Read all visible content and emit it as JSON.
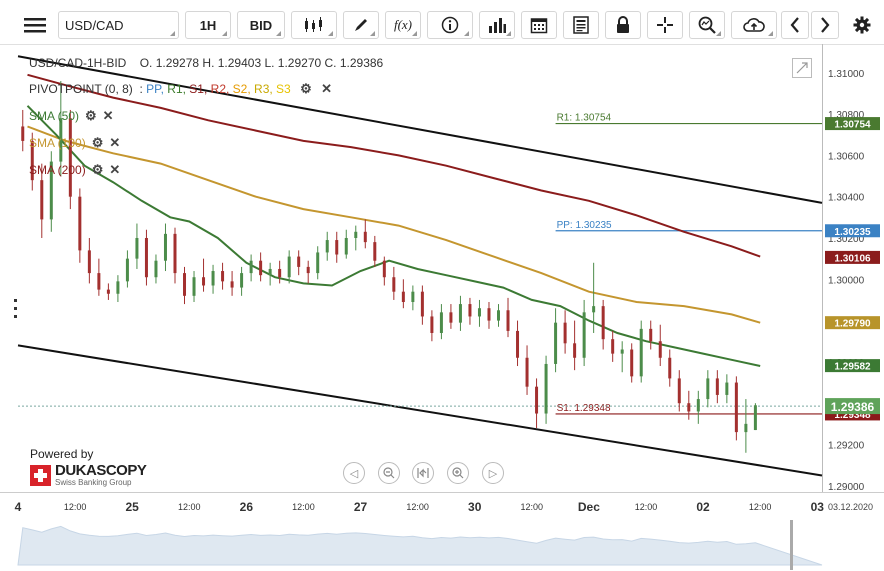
{
  "toolbar": {
    "symbol": "USD/CAD",
    "timeframe": "1H",
    "price_type": "BID",
    "icons": [
      "menu-icon",
      "candles-icon",
      "draw-icon",
      "function-icon",
      "info-icon",
      "bars-icon",
      "calendar-icon",
      "news-icon",
      "lock-icon",
      "crosshair-icon",
      "zoom-icon",
      "cloud-icon",
      "arrow-left-icon",
      "arrow-right-icon",
      "settings-icon"
    ],
    "function_label": "f(x)"
  },
  "header": {
    "instrument": "USD/CAD-1H-BID",
    "ohlc": "O. 1.29278 H. 1.29403 L. 1.29270 C. 1.29386"
  },
  "pivot": {
    "label": "PIVOTPOINT (0, 8)",
    "items": [
      {
        "text": "PP,",
        "color": "#3b82c4"
      },
      {
        "text": "R1,",
        "color": "#3a7a2a"
      },
      {
        "text": "S1,",
        "color": "#8b1a1a"
      },
      {
        "text": "R2,",
        "color": "#c0392b"
      },
      {
        "text": "S2,",
        "color": "#e69b00"
      },
      {
        "text": "R3,",
        "color": "#c8a800"
      },
      {
        "text": "S3",
        "color": "#e6c200"
      }
    ]
  },
  "indicators": [
    {
      "label": "SMA (50)",
      "color": "#3c7a34"
    },
    {
      "label": "SMA (100)",
      "color": "#c4962f"
    },
    {
      "label": "SMA (200)",
      "color": "#8b1c1c"
    }
  ],
  "branding": {
    "powered_by": "Powered by",
    "name": "DUKASCOPY",
    "tagline": "Swiss Banking Group"
  },
  "current_date": "03.12.2020",
  "chart_data": {
    "type": "candlestick",
    "y_ticks": [
      "1.31000",
      "1.30800",
      "1.30600",
      "1.30400",
      "1.30200",
      "1.30000",
      "1.29800",
      "1.29600",
      "1.29400",
      "1.29200",
      "1.29000"
    ],
    "ylim": [
      1.2897,
      1.3112
    ],
    "x_labels": [
      {
        "text": "4",
        "bold": true,
        "t": 0
      },
      {
        "text": "12:00",
        "bold": false,
        "t": 12
      },
      {
        "text": "25",
        "bold": true,
        "t": 24
      },
      {
        "text": "12:00",
        "bold": false,
        "t": 36
      },
      {
        "text": "26",
        "bold": true,
        "t": 48
      },
      {
        "text": "12:00",
        "bold": false,
        "t": 60
      },
      {
        "text": "27",
        "bold": true,
        "t": 72
      },
      {
        "text": "12:00",
        "bold": false,
        "t": 84
      },
      {
        "text": "30",
        "bold": true,
        "t": 96
      },
      {
        "text": "12:00",
        "bold": false,
        "t": 108
      },
      {
        "text": "Dec",
        "bold": true,
        "t": 120
      },
      {
        "text": "12:00",
        "bold": false,
        "t": 132
      },
      {
        "text": "02",
        "bold": true,
        "t": 144
      },
      {
        "text": "12:00",
        "bold": false,
        "t": 156
      },
      {
        "text": "03",
        "bold": true,
        "t": 168
      }
    ],
    "pivot_levels": [
      {
        "name": "R1",
        "label": "R1: 1.30754",
        "value": 1.30754,
        "color": "#4a7a30",
        "box": "1.30754"
      },
      {
        "name": "PP",
        "label": "PP: 1.30235",
        "value": 1.30235,
        "color": "#3b82c4",
        "box": "1.30235"
      },
      {
        "name": "S1",
        "label": "S1: 1.29348",
        "value": 1.29348,
        "color": "#8b1a1a",
        "box": "1.29348"
      }
    ],
    "sma_boxes": [
      {
        "value": 1.30106,
        "text": "1.30106",
        "color": "#8b1c1c"
      },
      {
        "value": 1.2979,
        "text": "1.29790",
        "color": "#b8942a"
      },
      {
        "value": 1.29582,
        "text": "1.29582",
        "color": "#3c7a34"
      }
    ],
    "last_price": {
      "value": 1.29386,
      "text": "1.29386",
      "color": "#5fa35a"
    },
    "sma50": [
      [
        2,
        1.3084
      ],
      [
        8,
        1.307
      ],
      [
        14,
        1.3055
      ],
      [
        20,
        1.3047
      ],
      [
        26,
        1.3038
      ],
      [
        32,
        1.303
      ],
      [
        36,
        1.3028
      ],
      [
        42,
        1.302
      ],
      [
        48,
        1.3008
      ],
      [
        54,
        1.3001
      ],
      [
        60,
        1.2998
      ],
      [
        66,
        1.2997
      ],
      [
        72,
        1.3004
      ],
      [
        78,
        1.3009
      ],
      [
        84,
        1.3005
      ],
      [
        90,
        1.3002
      ],
      [
        96,
        1.2999
      ],
      [
        102,
        1.2996
      ],
      [
        108,
        1.299
      ],
      [
        114,
        1.2987
      ],
      [
        120,
        1.298
      ],
      [
        126,
        1.2974
      ],
      [
        132,
        1.297
      ],
      [
        138,
        1.2967
      ],
      [
        144,
        1.2964
      ],
      [
        150,
        1.2961
      ],
      [
        156,
        1.2958
      ]
    ],
    "sma100": [
      [
        2,
        1.3074
      ],
      [
        10,
        1.3067
      ],
      [
        20,
        1.3061
      ],
      [
        30,
        1.3056
      ],
      [
        40,
        1.3048
      ],
      [
        50,
        1.304
      ],
      [
        60,
        1.3034
      ],
      [
        70,
        1.303
      ],
      [
        80,
        1.3026
      ],
      [
        90,
        1.3019
      ],
      [
        100,
        1.3011
      ],
      [
        110,
        1.3003
      ],
      [
        120,
        1.2994
      ],
      [
        130,
        1.2989
      ],
      [
        140,
        1.2987
      ],
      [
        150,
        1.2983
      ],
      [
        156,
        1.2979
      ]
    ],
    "sma200": [
      [
        2,
        1.3099
      ],
      [
        10,
        1.3094
      ],
      [
        20,
        1.3088
      ],
      [
        30,
        1.3083
      ],
      [
        40,
        1.3077
      ],
      [
        50,
        1.3072
      ],
      [
        60,
        1.3067
      ],
      [
        70,
        1.3064
      ],
      [
        80,
        1.306
      ],
      [
        90,
        1.3055
      ],
      [
        100,
        1.3049
      ],
      [
        110,
        1.3043
      ],
      [
        120,
        1.3038
      ],
      [
        130,
        1.3031
      ],
      [
        140,
        1.3023
      ],
      [
        150,
        1.3016
      ],
      [
        156,
        1.3011
      ]
    ],
    "channel_upper": [
      [
        0,
        1.3108
      ],
      [
        169,
        1.3037
      ]
    ],
    "channel_lower": [
      [
        0,
        1.2968
      ],
      [
        169,
        1.2905
      ]
    ],
    "candles": [
      {
        "t": 1,
        "o": 1.3074,
        "h": 1.3082,
        "l": 1.3062,
        "c": 1.3067
      },
      {
        "t": 3,
        "o": 1.3067,
        "h": 1.3071,
        "l": 1.3043,
        "c": 1.3048
      },
      {
        "t": 5,
        "o": 1.3048,
        "h": 1.3056,
        "l": 1.302,
        "c": 1.3029
      },
      {
        "t": 7,
        "o": 1.3029,
        "h": 1.3062,
        "l": 1.3023,
        "c": 1.3057
      },
      {
        "t": 9,
        "o": 1.3057,
        "h": 1.3096,
        "l": 1.305,
        "c": 1.3078
      },
      {
        "t": 11,
        "o": 1.3078,
        "h": 1.3082,
        "l": 1.3034,
        "c": 1.304
      },
      {
        "t": 13,
        "o": 1.304,
        "h": 1.3044,
        "l": 1.3008,
        "c": 1.3014
      },
      {
        "t": 15,
        "o": 1.3014,
        "h": 1.302,
        "l": 1.2998,
        "c": 1.3003
      },
      {
        "t": 17,
        "o": 1.3003,
        "h": 1.301,
        "l": 1.2992,
        "c": 1.2995
      },
      {
        "t": 19,
        "o": 1.2995,
        "h": 1.2998,
        "l": 1.299,
        "c": 1.2993
      },
      {
        "t": 21,
        "o": 1.2993,
        "h": 1.3002,
        "l": 1.2989,
        "c": 1.2999
      },
      {
        "t": 23,
        "o": 1.2999,
        "h": 1.3014,
        "l": 1.2996,
        "c": 1.301
      },
      {
        "t": 25,
        "o": 1.301,
        "h": 1.3027,
        "l": 1.3005,
        "c": 1.302
      },
      {
        "t": 27,
        "o": 1.302,
        "h": 1.3024,
        "l": 1.2997,
        "c": 1.3001
      },
      {
        "t": 29,
        "o": 1.3001,
        "h": 1.3012,
        "l": 1.2998,
        "c": 1.3009
      },
      {
        "t": 31,
        "o": 1.3009,
        "h": 1.3027,
        "l": 1.3004,
        "c": 1.3022
      },
      {
        "t": 33,
        "o": 1.3022,
        "h": 1.3025,
        "l": 1.2998,
        "c": 1.3003
      },
      {
        "t": 35,
        "o": 1.3003,
        "h": 1.3006,
        "l": 1.2988,
        "c": 1.2992
      },
      {
        "t": 37,
        "o": 1.2992,
        "h": 1.3004,
        "l": 1.2989,
        "c": 1.3001
      },
      {
        "t": 39,
        "o": 1.3001,
        "h": 1.301,
        "l": 1.2994,
        "c": 1.2997
      },
      {
        "t": 41,
        "o": 1.2997,
        "h": 1.3007,
        "l": 1.2993,
        "c": 1.3004
      },
      {
        "t": 43,
        "o": 1.3004,
        "h": 1.3008,
        "l": 1.2995,
        "c": 1.2999
      },
      {
        "t": 45,
        "o": 1.2999,
        "h": 1.3004,
        "l": 1.2992,
        "c": 1.2996
      },
      {
        "t": 47,
        "o": 1.2996,
        "h": 1.3006,
        "l": 1.2992,
        "c": 1.3003
      },
      {
        "t": 49,
        "o": 1.3003,
        "h": 1.3012,
        "l": 1.2999,
        "c": 1.3009
      },
      {
        "t": 51,
        "o": 1.3009,
        "h": 1.3013,
        "l": 1.2999,
        "c": 1.3002
      },
      {
        "t": 53,
        "o": 1.3002,
        "h": 1.3008,
        "l": 1.2997,
        "c": 1.3005
      },
      {
        "t": 55,
        "o": 1.3005,
        "h": 1.3009,
        "l": 1.2998,
        "c": 1.3001
      },
      {
        "t": 57,
        "o": 1.3001,
        "h": 1.3014,
        "l": 1.2998,
        "c": 1.3011
      },
      {
        "t": 59,
        "o": 1.3011,
        "h": 1.3014,
        "l": 1.3002,
        "c": 1.3006
      },
      {
        "t": 61,
        "o": 1.3006,
        "h": 1.3009,
        "l": 1.2998,
        "c": 1.3003
      },
      {
        "t": 63,
        "o": 1.3003,
        "h": 1.3016,
        "l": 1.3,
        "c": 1.3013
      },
      {
        "t": 65,
        "o": 1.3013,
        "h": 1.3023,
        "l": 1.3009,
        "c": 1.3019
      },
      {
        "t": 67,
        "o": 1.3019,
        "h": 1.3023,
        "l": 1.3008,
        "c": 1.3012
      },
      {
        "t": 69,
        "o": 1.3012,
        "h": 1.3024,
        "l": 1.301,
        "c": 1.302
      },
      {
        "t": 71,
        "o": 1.302,
        "h": 1.3026,
        "l": 1.3014,
        "c": 1.3023
      },
      {
        "t": 73,
        "o": 1.3023,
        "h": 1.3029,
        "l": 1.3015,
        "c": 1.3018
      },
      {
        "t": 75,
        "o": 1.3018,
        "h": 1.3021,
        "l": 1.3006,
        "c": 1.3009
      },
      {
        "t": 77,
        "o": 1.3009,
        "h": 1.3011,
        "l": 1.2997,
        "c": 1.3001
      },
      {
        "t": 79,
        "o": 1.3001,
        "h": 1.3006,
        "l": 1.299,
        "c": 1.2994
      },
      {
        "t": 81,
        "o": 1.2994,
        "h": 1.3,
        "l": 1.2986,
        "c": 1.2989
      },
      {
        "t": 83,
        "o": 1.2989,
        "h": 1.2997,
        "l": 1.2985,
        "c": 1.2994
      },
      {
        "t": 85,
        "o": 1.2994,
        "h": 1.2997,
        "l": 1.2978,
        "c": 1.2982
      },
      {
        "t": 87,
        "o": 1.2982,
        "h": 1.2985,
        "l": 1.297,
        "c": 1.2974
      },
      {
        "t": 89,
        "o": 1.2974,
        "h": 1.2988,
        "l": 1.2971,
        "c": 1.2984
      },
      {
        "t": 91,
        "o": 1.2984,
        "h": 1.2988,
        "l": 1.2976,
        "c": 1.2979
      },
      {
        "t": 93,
        "o": 1.2979,
        "h": 1.2992,
        "l": 1.2975,
        "c": 1.2988
      },
      {
        "t": 95,
        "o": 1.2988,
        "h": 1.2991,
        "l": 1.2978,
        "c": 1.2982
      },
      {
        "t": 97,
        "o": 1.2982,
        "h": 1.299,
        "l": 1.2977,
        "c": 1.2986
      },
      {
        "t": 99,
        "o": 1.2986,
        "h": 1.2989,
        "l": 1.2976,
        "c": 1.298
      },
      {
        "t": 101,
        "o": 1.298,
        "h": 1.2988,
        "l": 1.2977,
        "c": 1.2985
      },
      {
        "t": 103,
        "o": 1.2985,
        "h": 1.2991,
        "l": 1.2972,
        "c": 1.2975
      },
      {
        "t": 105,
        "o": 1.2975,
        "h": 1.298,
        "l": 1.2958,
        "c": 1.2962
      },
      {
        "t": 107,
        "o": 1.2962,
        "h": 1.2968,
        "l": 1.2944,
        "c": 1.2948
      },
      {
        "t": 109,
        "o": 1.2948,
        "h": 1.2952,
        "l": 1.2928,
        "c": 1.2935
      },
      {
        "t": 111,
        "o": 1.2935,
        "h": 1.2963,
        "l": 1.293,
        "c": 1.2959
      },
      {
        "t": 113,
        "o": 1.2959,
        "h": 1.2986,
        "l": 1.2955,
        "c": 1.2979
      },
      {
        "t": 115,
        "o": 1.2979,
        "h": 1.2985,
        "l": 1.2964,
        "c": 1.2969
      },
      {
        "t": 117,
        "o": 1.2969,
        "h": 1.298,
        "l": 1.2956,
        "c": 1.2962
      },
      {
        "t": 119,
        "o": 1.2962,
        "h": 1.299,
        "l": 1.2958,
        "c": 1.2984
      },
      {
        "t": 121,
        "o": 1.2984,
        "h": 1.3008,
        "l": 1.2974,
        "c": 1.2987
      },
      {
        "t": 123,
        "o": 1.2987,
        "h": 1.299,
        "l": 1.2966,
        "c": 1.2971
      },
      {
        "t": 125,
        "o": 1.2971,
        "h": 1.2975,
        "l": 1.296,
        "c": 1.2964
      },
      {
        "t": 127,
        "o": 1.2964,
        "h": 1.297,
        "l": 1.2955,
        "c": 1.2966
      },
      {
        "t": 129,
        "o": 1.2966,
        "h": 1.2969,
        "l": 1.295,
        "c": 1.2953
      },
      {
        "t": 131,
        "o": 1.2953,
        "h": 1.298,
        "l": 1.295,
        "c": 1.2976
      },
      {
        "t": 133,
        "o": 1.2976,
        "h": 1.298,
        "l": 1.2966,
        "c": 1.297
      },
      {
        "t": 135,
        "o": 1.297,
        "h": 1.2978,
        "l": 1.2958,
        "c": 1.2962
      },
      {
        "t": 137,
        "o": 1.2962,
        "h": 1.2966,
        "l": 1.2948,
        "c": 1.2952
      },
      {
        "t": 139,
        "o": 1.2952,
        "h": 1.2956,
        "l": 1.2936,
        "c": 1.294
      },
      {
        "t": 141,
        "o": 1.294,
        "h": 1.2946,
        "l": 1.2932,
        "c": 1.2936
      },
      {
        "t": 143,
        "o": 1.2936,
        "h": 1.2946,
        "l": 1.293,
        "c": 1.2942
      },
      {
        "t": 145,
        "o": 1.2942,
        "h": 1.2956,
        "l": 1.2938,
        "c": 1.2952
      },
      {
        "t": 147,
        "o": 1.2952,
        "h": 1.2956,
        "l": 1.294,
        "c": 1.2944
      },
      {
        "t": 149,
        "o": 1.2944,
        "h": 1.2954,
        "l": 1.294,
        "c": 1.295
      },
      {
        "t": 151,
        "o": 1.295,
        "h": 1.2953,
        "l": 1.2922,
        "c": 1.2926
      },
      {
        "t": 153,
        "o": 1.2926,
        "h": 1.2942,
        "l": 1.2916,
        "c": 1.293
      },
      {
        "t": 155,
        "o": 1.2927,
        "h": 1.294,
        "l": 1.2927,
        "c": 1.2939
      }
    ]
  }
}
